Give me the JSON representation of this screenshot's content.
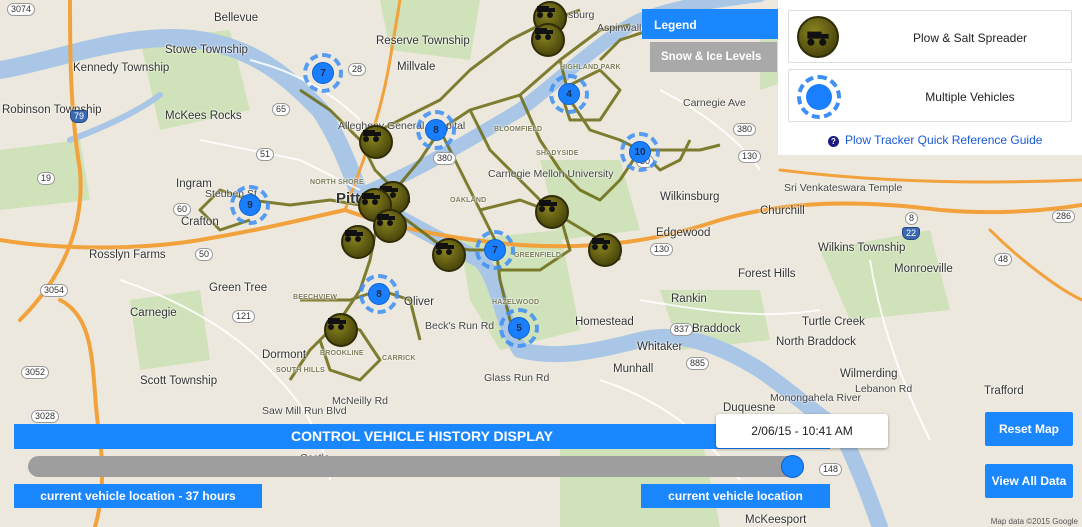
{
  "legend": {
    "tab_label": "Legend",
    "snow_tab_label": "Snow & Ice Levels",
    "plow_label": "Plow & Salt Spreader",
    "cluster_label": "Multiple Vehicles",
    "guide_link": "Plow Tracker Quick Reference Guide"
  },
  "history": {
    "title": "CONTROL VEHICLE HISTORY DISPLAY",
    "timestamp": "2/06/15 - 10:41 AM",
    "range_start": "current vehicle location - 37 hours",
    "range_end": "current vehicle location",
    "position_fraction": 1.0
  },
  "buttons": {
    "reset_map": "Reset Map",
    "view_all": "View All Data"
  },
  "clusters": [
    "7",
    "8",
    "4",
    "10",
    "9",
    "7",
    "8",
    "5"
  ],
  "map": {
    "city": "Pittsburgh",
    "places": [
      "Bellevue",
      "Reserve Township",
      "Millvale",
      "Stowe Township",
      "Kennedy Township",
      "McKees Rocks",
      "Robinson Township",
      "Allegheny General Hospital",
      "Ingram",
      "Crafton",
      "Carnegie Mellon University",
      "Wilkinsburg",
      "Churchill",
      "Sri Venkateswara Temple",
      "Edgewood",
      "Wilkins Township",
      "Monroeville",
      "Rosslyn Farms",
      "Green Tree",
      "Forest Hills",
      "Carnegie",
      "Oliver",
      "Rankin",
      "Turtle Creek",
      "Homestead",
      "Braddock",
      "North Braddock",
      "Whitaker",
      "Dormont",
      "Munhall",
      "Scott Township",
      "Wilmerding",
      "Trafford",
      "Duquesne",
      "McKeesport",
      "Castle",
      "Aspinwall",
      "Sharpsburg"
    ],
    "neighborhoods": [
      "NORTH SHORE",
      "BLOOMFIELD",
      "SHADYSIDE",
      "OAKLAND",
      "GREENFIELD",
      "HAZELWOOD",
      "BEECHVIEW",
      "BROOKLINE",
      "CARRICK",
      "SOUTH HILLS",
      "HIGHLAND PARK"
    ],
    "roads": [
      "Glass Run Rd",
      "Beck's Run Rd",
      "McNeilly Rd",
      "Saw Mill Run Blvd",
      "Lebanon Rd",
      "Monongahela River",
      "Steuben St",
      "Carnegie Ave"
    ],
    "shields": [
      "3074",
      "65",
      "28",
      "79",
      "51",
      "380",
      "19",
      "60",
      "50",
      "121",
      "3054",
      "3052",
      "3028",
      "30",
      "130",
      "837",
      "885",
      "8",
      "130",
      "380",
      "22",
      "48",
      "286",
      "148"
    ],
    "attribution": "Map data ©2015 Google"
  },
  "colors": {
    "accent": "#1a87ff",
    "plow_track": "#6b6a12",
    "water": "#a9c6e6",
    "highway": "#f2a23c"
  }
}
